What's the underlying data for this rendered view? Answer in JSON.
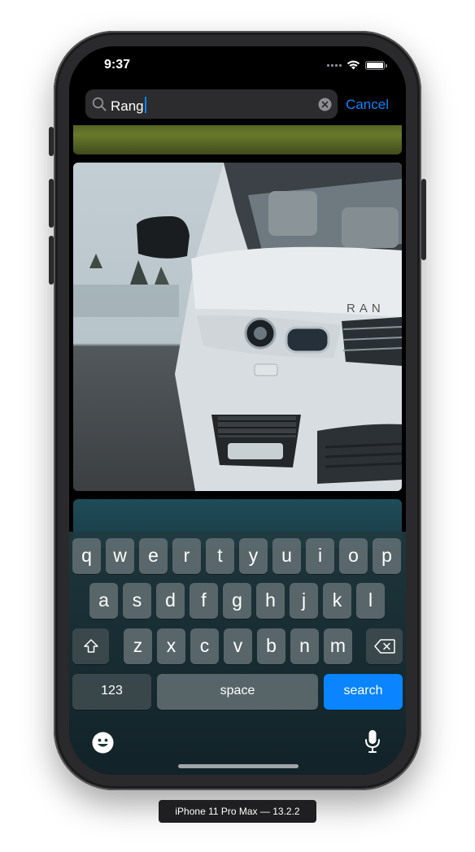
{
  "status_bar": {
    "time": "9:37"
  },
  "search": {
    "query": "Rang",
    "cancel_label": "Cancel"
  },
  "car_photo": {
    "badge_text": "RAN"
  },
  "keyboard": {
    "row1": [
      "q",
      "w",
      "e",
      "r",
      "t",
      "y",
      "u",
      "i",
      "o",
      "p"
    ],
    "row2": [
      "a",
      "s",
      "d",
      "f",
      "g",
      "h",
      "j",
      "k",
      "l"
    ],
    "row3": [
      "z",
      "x",
      "c",
      "v",
      "b",
      "n",
      "m"
    ],
    "numbers_label": "123",
    "space_label": "space",
    "search_label": "search"
  },
  "device": {
    "label": "iPhone 11 Pro Max — 13.2.2"
  },
  "colors": {
    "accent": "#0a84ff",
    "keyboard_bg": "#1e3a40"
  },
  "icons": [
    "search-icon",
    "clear-icon",
    "shift-icon",
    "delete-icon",
    "emoji-icon",
    "microphone-icon",
    "wifi-icon",
    "battery-icon"
  ]
}
